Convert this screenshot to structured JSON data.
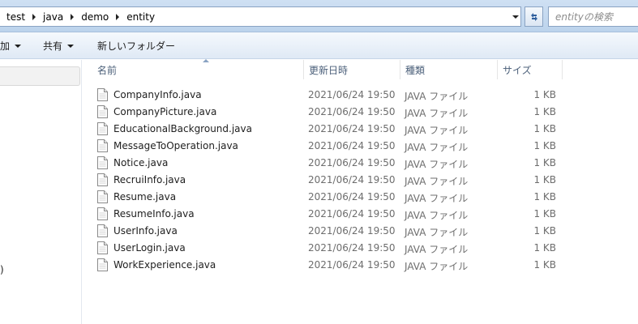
{
  "address_bar": {
    "crumbs": [
      "test",
      "java",
      "demo",
      "entity"
    ]
  },
  "search": {
    "placeholder": "entityの検索"
  },
  "toolbar": {
    "organize_fragment": "加",
    "share_label": "共有",
    "new_folder_label": "新しいフォルダー"
  },
  "nav_pane": {
    "fragment": ")"
  },
  "columns": {
    "name": "名前",
    "date": "更新日時",
    "type": "種類",
    "size": "サイズ"
  },
  "files": [
    {
      "name": "CompanyInfo.java",
      "date": "2021/06/24 19:50",
      "type": "JAVA ファイル",
      "size": "1 KB"
    },
    {
      "name": "CompanyPicture.java",
      "date": "2021/06/24 19:50",
      "type": "JAVA ファイル",
      "size": "1 KB"
    },
    {
      "name": "EducationalBackground.java",
      "date": "2021/06/24 19:50",
      "type": "JAVA ファイル",
      "size": "1 KB"
    },
    {
      "name": "MessageToOperation.java",
      "date": "2021/06/24 19:50",
      "type": "JAVA ファイル",
      "size": "1 KB"
    },
    {
      "name": "Notice.java",
      "date": "2021/06/24 19:50",
      "type": "JAVA ファイル",
      "size": "1 KB"
    },
    {
      "name": "RecruiInfo.java",
      "date": "2021/06/24 19:50",
      "type": "JAVA ファイル",
      "size": "1 KB"
    },
    {
      "name": "Resume.java",
      "date": "2021/06/24 19:50",
      "type": "JAVA ファイル",
      "size": "1 KB"
    },
    {
      "name": "ResumeInfo.java",
      "date": "2021/06/24 19:50",
      "type": "JAVA ファイル",
      "size": "1 KB"
    },
    {
      "name": "UserInfo.java",
      "date": "2021/06/24 19:50",
      "type": "JAVA ファイル",
      "size": "1 KB"
    },
    {
      "name": "UserLogin.java",
      "date": "2021/06/24 19:50",
      "type": "JAVA ファイル",
      "size": "1 KB"
    },
    {
      "name": "WorkExperience.java",
      "date": "2021/06/24 19:50",
      "type": "JAVA ファイル",
      "size": "1 KB"
    }
  ]
}
